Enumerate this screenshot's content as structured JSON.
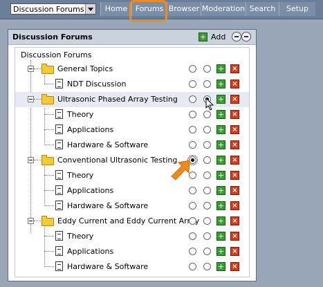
{
  "topbar": {
    "select_value": "Discussion Forums",
    "tabs": [
      {
        "label": "Home"
      },
      {
        "label": "Forums"
      },
      {
        "label": "Browser"
      },
      {
        "label": "Moderation"
      },
      {
        "label": "Search"
      },
      {
        "label": "Setup"
      }
    ],
    "active_tab": "Forums"
  },
  "panel": {
    "title": "Discussion Forums",
    "add_label": "Add",
    "root_label": "Discussion Forums"
  },
  "tree": [
    {
      "label": "General Topics",
      "type": "folder",
      "selected": false
    },
    {
      "label": "NDT Discussion",
      "type": "doc",
      "selected": false
    },
    {
      "label": "Ultrasonic Phased Array Testing",
      "type": "folder",
      "selected": true
    },
    {
      "label": "Theory",
      "type": "doc",
      "selected": false
    },
    {
      "label": "Applications",
      "type": "doc",
      "selected": false
    },
    {
      "label": "Hardware & Software",
      "type": "doc",
      "selected": false
    },
    {
      "label": "Conventional Ultrasonic Testing",
      "type": "folder",
      "selected": true
    },
    {
      "label": "Theory",
      "type": "doc",
      "selected": false
    },
    {
      "label": "Applications",
      "type": "doc",
      "selected": false
    },
    {
      "label": "Hardware & Software",
      "type": "doc",
      "selected": false
    },
    {
      "label": "Eddy Current and Eddy Current Array",
      "type": "folder",
      "selected": false
    },
    {
      "label": "Theory",
      "type": "doc",
      "selected": false
    },
    {
      "label": "Applications",
      "type": "doc",
      "selected": false
    },
    {
      "label": "Hardware & Software",
      "type": "doc",
      "selected": false
    }
  ],
  "colors": {
    "accent_ring": "#f08a1c",
    "add_green": "#33a02c",
    "delete_red": "#d93a17",
    "folder_yellow": "#f5cb34"
  }
}
